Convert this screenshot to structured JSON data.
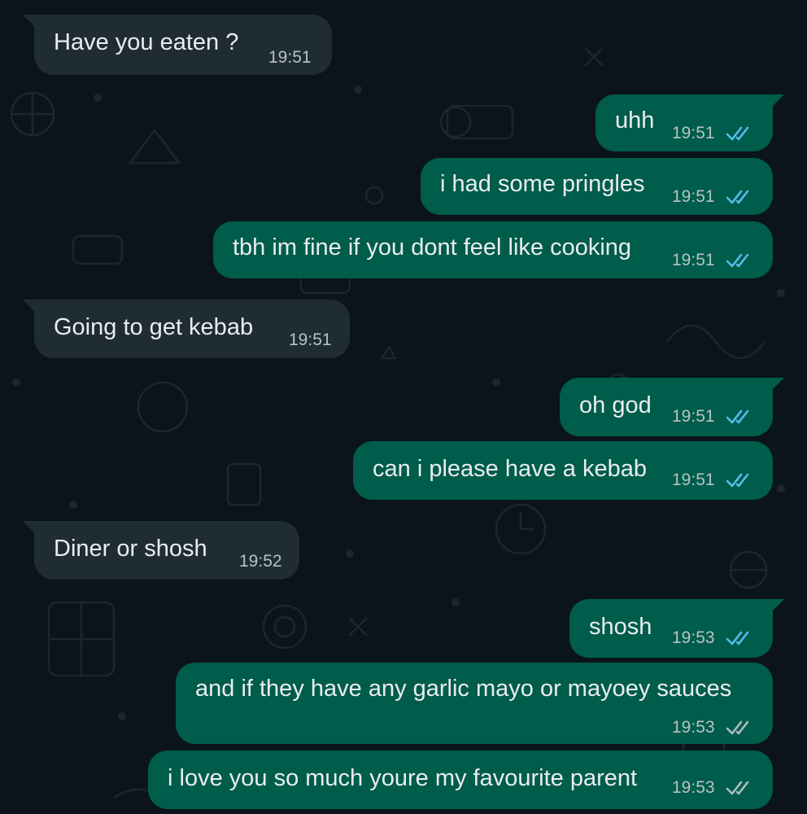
{
  "colors": {
    "background": "#0b141a",
    "incoming_bubble": "#202c33",
    "outgoing_bubble": "#005c4b",
    "read_ticks": "#53bdeb",
    "delivered_ticks": "#aebac1"
  },
  "messages": [
    {
      "direction": "incoming",
      "text": "Have you eaten ?",
      "time": "19:51"
    },
    {
      "direction": "outgoing",
      "text": "uhh",
      "time": "19:51",
      "status": "read"
    },
    {
      "direction": "outgoing",
      "text": "i had some pringles",
      "time": "19:51",
      "status": "read"
    },
    {
      "direction": "outgoing",
      "text": "tbh im fine if you dont feel like cooking",
      "time": "19:51",
      "status": "read"
    },
    {
      "direction": "incoming",
      "text": "Going to get kebab",
      "time": "19:51"
    },
    {
      "direction": "outgoing",
      "text": "oh god",
      "time": "19:51",
      "status": "read"
    },
    {
      "direction": "outgoing",
      "text": "can i please have a kebab",
      "time": "19:51",
      "status": "read"
    },
    {
      "direction": "incoming",
      "text": "Diner or shosh",
      "time": "19:52"
    },
    {
      "direction": "outgoing",
      "text": "shosh",
      "time": "19:53",
      "status": "read"
    },
    {
      "direction": "outgoing",
      "text": "and if they have any garlic mayo or mayoey sauces",
      "time": "19:53",
      "status": "delivered"
    },
    {
      "direction": "outgoing",
      "text": "i love you so much youre my favourite parent",
      "time": "19:53",
      "status": "delivered"
    }
  ]
}
